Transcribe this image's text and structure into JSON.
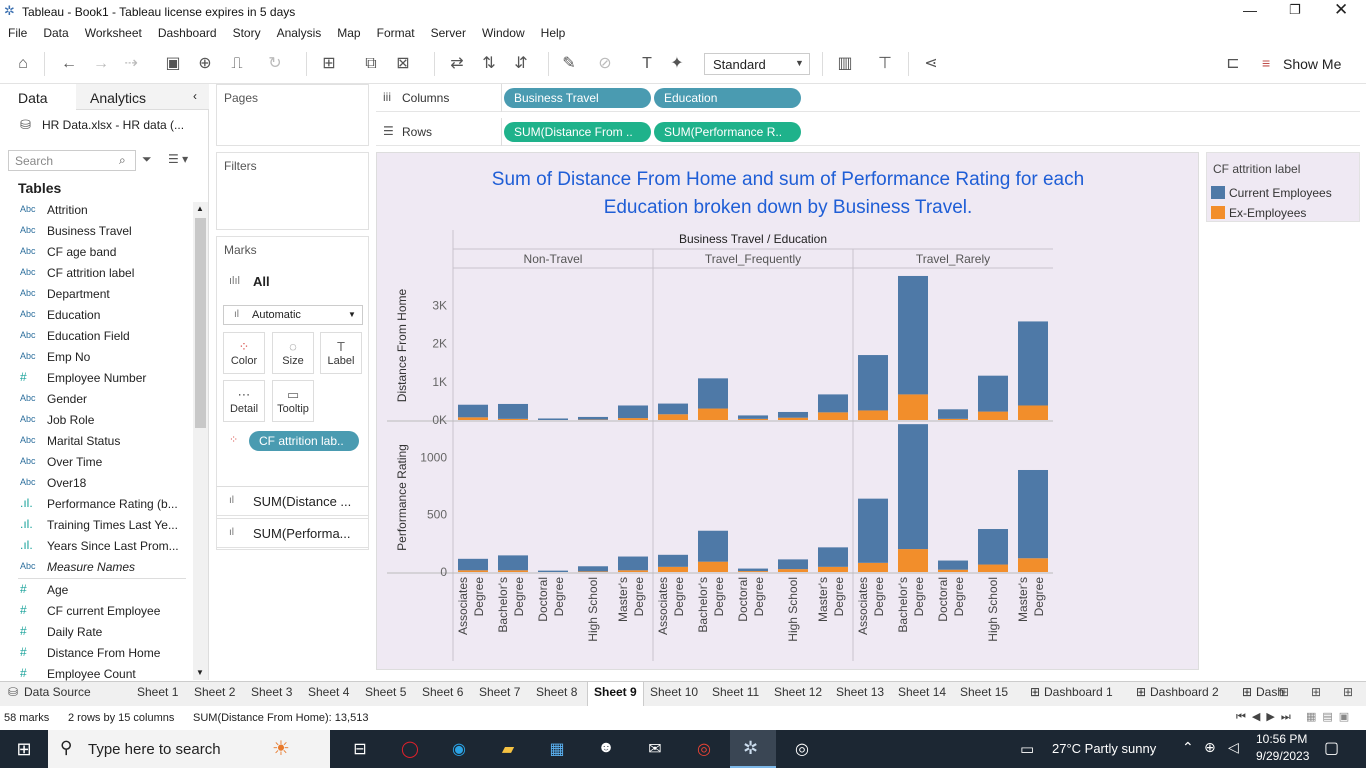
{
  "window": {
    "title": "Tableau - Book1 - Tableau license expires in 5 days"
  },
  "menu": [
    "File",
    "Data",
    "Worksheet",
    "Dashboard",
    "Story",
    "Analysis",
    "Map",
    "Format",
    "Server",
    "Window",
    "Help"
  ],
  "toolbar": {
    "fit_mode": "Standard",
    "show_me": "Show Me"
  },
  "left_pane": {
    "tab_data": "Data",
    "tab_analytics": "Analytics",
    "datasource": "HR Data.xlsx - HR data (...",
    "search_placeholder": "Search",
    "tables_heading": "Tables",
    "fields": [
      {
        "type": "Abc",
        "name": "Attrition"
      },
      {
        "type": "Abc",
        "name": "Business Travel"
      },
      {
        "type": "Abc",
        "name": "CF age band"
      },
      {
        "type": "Abc",
        "name": "CF attrition label"
      },
      {
        "type": "Abc",
        "name": "Department"
      },
      {
        "type": "Abc",
        "name": "Education"
      },
      {
        "type": "Abc",
        "name": "Education Field"
      },
      {
        "type": "Abc",
        "name": "Emp No"
      },
      {
        "type": "#",
        "name": "Employee Number"
      },
      {
        "type": "Abc",
        "name": "Gender"
      },
      {
        "type": "Abc",
        "name": "Job Role"
      },
      {
        "type": "Abc",
        "name": "Marital Status"
      },
      {
        "type": "Abc",
        "name": "Over Time"
      },
      {
        "type": "Abc",
        "name": "Over18"
      },
      {
        "type": ".ıl.",
        "name": "Performance Rating (b..."
      },
      {
        "type": ".ıl.",
        "name": "Training Times Last Ye..."
      },
      {
        "type": ".ıl.",
        "name": "Years Since Last Prom..."
      },
      {
        "type": "Abc",
        "name": "Measure Names"
      }
    ],
    "measures": [
      {
        "type": "#",
        "name": "Age"
      },
      {
        "type": "#",
        "name": "CF current Employee"
      },
      {
        "type": "#",
        "name": "Daily Rate"
      },
      {
        "type": "#",
        "name": "Distance From Home"
      },
      {
        "type": "#",
        "name": "Employee Count"
      }
    ]
  },
  "cards": {
    "pages": "Pages",
    "filters": "Filters",
    "marks": "Marks",
    "marks_all": "All",
    "mark_type": "Automatic",
    "buttons": [
      "Color",
      "Size",
      "Label",
      "Detail",
      "Tooltip"
    ],
    "color_pill": "CF attrition lab..",
    "sum1": "SUM(Distance ...",
    "sum2": "SUM(Performa..."
  },
  "shelves": {
    "columns_label": "Columns",
    "rows_label": "Rows",
    "columns": [
      "Business Travel",
      "Education"
    ],
    "rows": [
      "SUM(Distance From ..",
      "SUM(Performance R.."
    ]
  },
  "legend": {
    "title": "CF attrition label",
    "items": [
      {
        "label": "Current Employees",
        "color": "#4e79a7"
      },
      {
        "label": "Ex-Employees",
        "color": "#f28e2b"
      }
    ]
  },
  "chart_data": {
    "type": "bar",
    "title": "Sum of Distance From Home and sum of Performance Rating for each Education broken down by Business Travel.",
    "header": "Business Travel / Education",
    "groups": [
      "Non-Travel",
      "Travel_Frequently",
      "Travel_Rarely"
    ],
    "categories": [
      "Associates Degree",
      "Bachelor's Degree",
      "Doctoral Degree",
      "High School",
      "Master's Degree"
    ],
    "stacked": true,
    "series_colors": {
      "Current Employees": "#4e79a7",
      "Ex-Employees": "#f28e2b"
    },
    "panels": [
      {
        "ylabel": "Distance From Home",
        "yticks": [
          {
            "v": 0,
            "l": "0K"
          },
          {
            "v": 1000,
            "l": "1K"
          },
          {
            "v": 2000,
            "l": "2K"
          },
          {
            "v": 3000,
            "l": "3K"
          }
        ],
        "ylim": [
          0,
          3900
        ],
        "data": {
          "Non-Travel": {
            "Current Employees": [
              330,
              390,
              40,
              70,
              330
            ],
            "Ex-Employees": [
              70,
              30,
              0,
              10,
              50
            ]
          },
          "Travel_Frequently": {
            "Current Employees": [
              280,
              790,
              90,
              150,
              470
            ],
            "Ex-Employees": [
              150,
              300,
              30,
              60,
              200
            ]
          },
          "Travel_Rarely": {
            "Current Employees": [
              1450,
              3100,
              250,
              940,
              2200
            ],
            "Ex-Employees": [
              250,
              670,
              30,
              220,
              380
            ]
          }
        }
      },
      {
        "ylabel": "Performance Rating",
        "yticks": [
          {
            "v": 0,
            "l": "0"
          },
          {
            "v": 500,
            "l": "500"
          },
          {
            "v": 1000,
            "l": "1000"
          }
        ],
        "ylim": [
          0,
          1300
        ],
        "data": {
          "Non-Travel": {
            "Current Employees": [
              100,
              130,
              12,
              45,
              120
            ],
            "Ex-Employees": [
              15,
              15,
              0,
              5,
              15
            ]
          },
          "Travel_Frequently": {
            "Current Employees": [
              105,
              270,
              22,
              85,
              170
            ],
            "Ex-Employees": [
              45,
              90,
              8,
              25,
              45
            ]
          },
          "Travel_Rarely": {
            "Current Employees": [
              560,
              1090,
              80,
              310,
              770
            ],
            "Ex-Employees": [
              80,
              200,
              20,
              65,
              120
            ]
          }
        }
      }
    ]
  },
  "sheet_tabs": {
    "data_source": "Data Source",
    "sheets": [
      "Sheet 1",
      "Sheet 2",
      "Sheet 3",
      "Sheet 4",
      "Sheet 5",
      "Sheet 6",
      "Sheet 7",
      "Sheet 8",
      "Sheet 9",
      "Sheet 10",
      "Sheet 11",
      "Sheet 12",
      "Sheet 13",
      "Sheet 14",
      "Sheet 15"
    ],
    "selected": "Sheet 9",
    "dashboards": [
      "Dashboard 1",
      "Dashboard 2",
      "Dash"
    ]
  },
  "status": {
    "marks": "58 marks",
    "rows_cols": "2 rows by 15 columns",
    "sum": "SUM(Distance From Home): 13,513"
  },
  "taskbar": {
    "search_placeholder": "Type here to search",
    "weather": "27°C  Partly sunny",
    "time": "10:56 PM",
    "date": "9/29/2023"
  }
}
